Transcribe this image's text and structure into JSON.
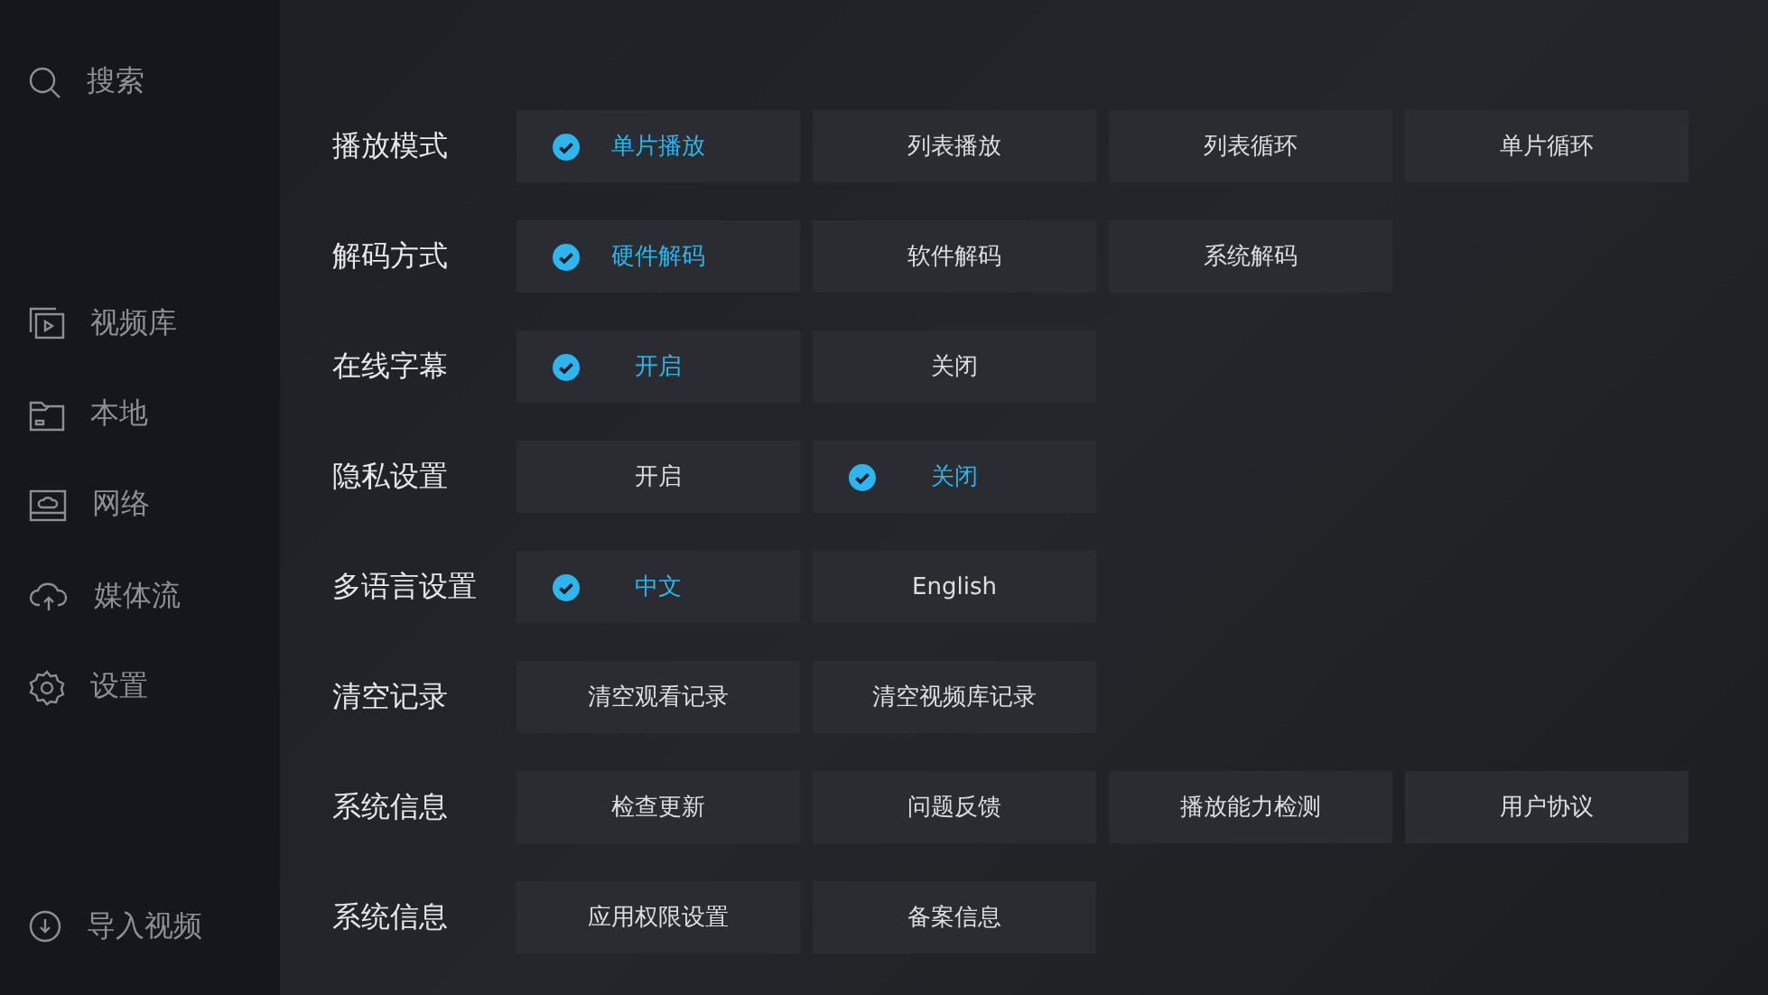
{
  "sidebar": {
    "search": {
      "label": "搜索"
    },
    "items": [
      {
        "label": "视频库",
        "kind": "library"
      },
      {
        "label": "本地",
        "kind": "folder"
      },
      {
        "label": "网络",
        "kind": "network"
      },
      {
        "label": "媒体流",
        "kind": "cloud"
      },
      {
        "label": "设置",
        "kind": "settings"
      }
    ],
    "import": {
      "label": "导入视频"
    }
  },
  "settings": [
    {
      "label": "播放模式",
      "options": [
        {
          "label": "单片播放",
          "selected": true
        },
        {
          "label": "列表播放",
          "selected": false
        },
        {
          "label": "列表循环",
          "selected": false
        },
        {
          "label": "单片循环",
          "selected": false
        }
      ]
    },
    {
      "label": "解码方式",
      "options": [
        {
          "label": "硬件解码",
          "selected": true
        },
        {
          "label": "软件解码",
          "selected": false
        },
        {
          "label": "系统解码",
          "selected": false
        }
      ]
    },
    {
      "label": "在线字幕",
      "options": [
        {
          "label": "开启",
          "selected": true
        },
        {
          "label": "关闭",
          "selected": false
        }
      ]
    },
    {
      "label": "隐私设置",
      "options": [
        {
          "label": "开启",
          "selected": false
        },
        {
          "label": "关闭",
          "selected": true
        }
      ]
    },
    {
      "label": "多语言设置",
      "options": [
        {
          "label": "中文",
          "selected": true
        },
        {
          "label": "English",
          "selected": false
        }
      ]
    },
    {
      "label": "清空记录",
      "options": [
        {
          "label": "清空观看记录",
          "selected": false
        },
        {
          "label": "清空视频库记录",
          "selected": false
        }
      ]
    },
    {
      "label": "系统信息",
      "options": [
        {
          "label": "检查更新",
          "selected": false
        },
        {
          "label": "问题反馈",
          "selected": false
        },
        {
          "label": "播放能力检测",
          "selected": false
        },
        {
          "label": "用户协议",
          "selected": false
        }
      ]
    },
    {
      "label": "系统信息",
      "options": [
        {
          "label": "应用权限设置",
          "selected": false
        },
        {
          "label": "备案信息",
          "selected": false
        }
      ]
    }
  ]
}
